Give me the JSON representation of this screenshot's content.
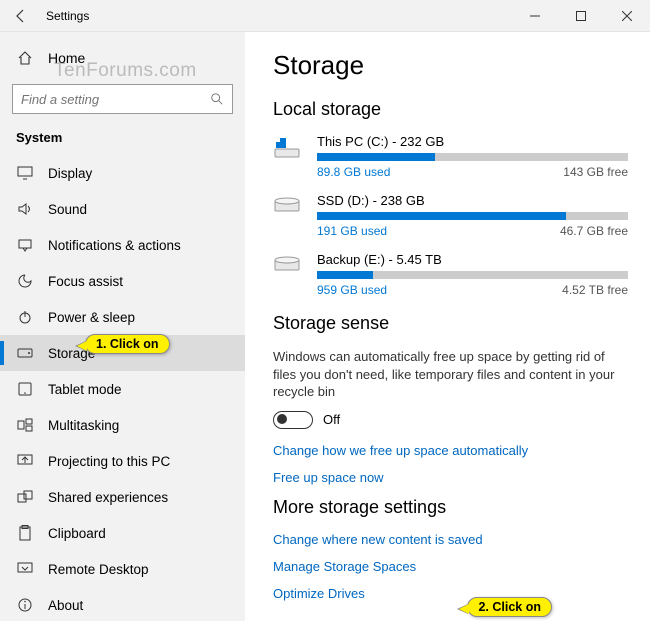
{
  "window": {
    "title": "Settings"
  },
  "watermark": "TenForums.com",
  "sidebar": {
    "home": "Home",
    "search_placeholder": "Find a setting",
    "category": "System",
    "items": [
      {
        "label": "Display"
      },
      {
        "label": "Sound"
      },
      {
        "label": "Notifications & actions"
      },
      {
        "label": "Focus assist"
      },
      {
        "label": "Power & sleep"
      },
      {
        "label": "Storage"
      },
      {
        "label": "Tablet mode"
      },
      {
        "label": "Multitasking"
      },
      {
        "label": "Projecting to this PC"
      },
      {
        "label": "Shared experiences"
      },
      {
        "label": "Clipboard"
      },
      {
        "label": "Remote Desktop"
      },
      {
        "label": "About"
      }
    ]
  },
  "main": {
    "title": "Storage",
    "local_storage_heading": "Local storage",
    "drives": [
      {
        "name": "This PC (C:) - 232 GB",
        "used": "89.8 GB used",
        "free": "143 GB free",
        "pct": 38
      },
      {
        "name": "SSD (D:) - 238 GB",
        "used": "191 GB used",
        "free": "46.7 GB free",
        "pct": 80
      },
      {
        "name": "Backup (E:) - 5.45 TB",
        "used": "959 GB used",
        "free": "4.52 TB free",
        "pct": 18
      }
    ],
    "sense": {
      "heading": "Storage sense",
      "description": "Windows can automatically free up space by getting rid of files you don't need, like temporary files and content in your recycle bin",
      "toggle_label": "Off",
      "link_change": "Change how we free up space automatically",
      "link_freeup": "Free up space now"
    },
    "more": {
      "heading": "More storage settings",
      "link_newcontent": "Change where new content is saved",
      "link_spaces": "Manage Storage Spaces",
      "link_optimize": "Optimize Drives"
    }
  },
  "callouts": {
    "c1": "1. Click on",
    "c2": "2. Click on"
  }
}
